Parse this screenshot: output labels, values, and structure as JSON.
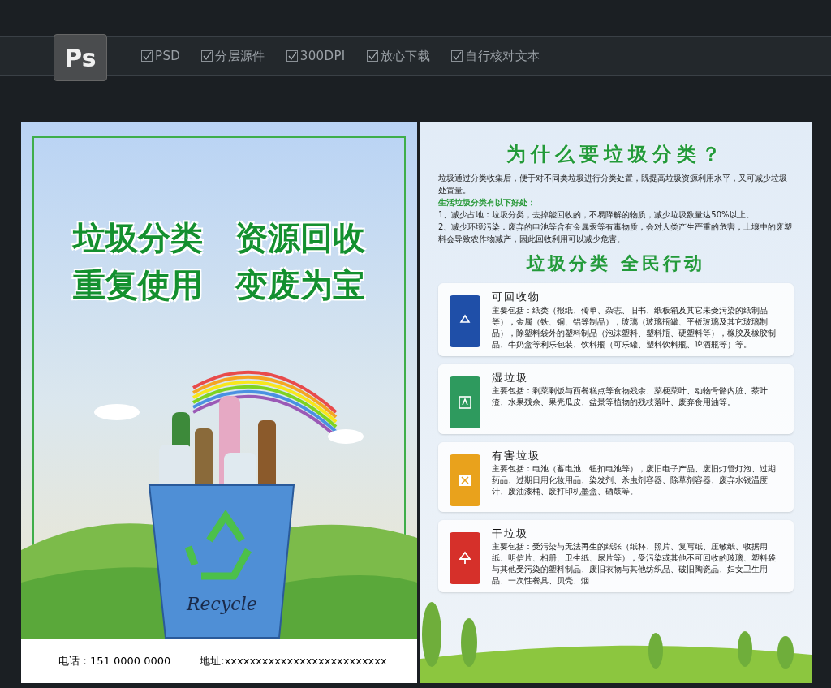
{
  "header": {
    "app_badge": "Ps",
    "features": [
      {
        "label": "PSD",
        "checked": true
      },
      {
        "label": "分层源件",
        "checked": true
      },
      {
        "label": "300DPI",
        "checked": true
      },
      {
        "label": "放心下载",
        "checked": true
      },
      {
        "label": "自行核对文本",
        "checked": true
      }
    ]
  },
  "front": {
    "slogan_lines": [
      "垃圾分类　资源回收",
      "重复使用　变废为宝"
    ],
    "bin_label": "Recycle",
    "phone": "电话：151 0000 0000",
    "address": "地址:xxxxxxxxxxxxxxxxxxxxxxxxxx"
  },
  "back": {
    "title": "为什么要垃圾分类？",
    "intro": "垃圾通过分类收集后，便于对不同类垃圾进行分类处置，既提高垃圾资源利用水平，又可减少垃圾处置量。",
    "benefits_heading": "生活垃圾分类有以下好处：",
    "benefits": [
      "1、减少占地：垃圾分类，去掉能回收的，不易降解的物质，减少垃圾数量达50%以上。",
      "2、减少环境污染：废弃的电池等含有金属汞等有毒物质，会对人类产生严重的危害，土壤中的废塑料会导致农作物减产，因此回收利用可以减少危害。"
    ],
    "subtitle": "垃圾分类 全民行动",
    "categories": [
      {
        "name": "可回收物",
        "color": "#1f4fa8",
        "kind": "recycle",
        "text": "主要包括：纸类（报纸、传单、杂志、旧书、纸板箱及其它未受污染的纸制品等），金属（铁、铜、铝等制品），玻璃（玻璃瓶罐、平板玻璃及其它玻璃制品），除塑料袋外的塑料制品（泡沫塑料、塑料瓶、硬塑料等），橡胶及橡胶制品、牛奶盒等利乐包装、饮料瓶（可乐罐、塑料饮料瓶、啤酒瓶等）等。"
      },
      {
        "name": "湿垃圾",
        "color": "#2e9a5e",
        "kind": "food",
        "text": "主要包括：剩菜剩饭与西餐糕点等食物残余、菜梗菜叶、动物骨骼内脏、茶叶渣、水果残余、果壳瓜皮、盆景等植物的残枝落叶、废弃食用油等。"
      },
      {
        "name": "有害垃圾",
        "color": "#e9a21c",
        "kind": "hazard",
        "text": "主要包括：电池（蓄电池、钮扣电池等），废旧电子产品、废旧灯管灯泡、过期药品、过期日用化妆用品、染发剂、杀虫剂容器、除草剂容器、废弃水银温度计、废油漆桶、废打印机墨盒、硒鼓等。"
      },
      {
        "name": "干垃圾",
        "color": "#d6302a",
        "kind": "tree",
        "text": "主要包括：受污染与无法再生的纸张（纸杯、照片、复写纸、压敏纸、收据用纸、明信片、相册、卫生纸、尿片等），受污染或其他不可回收的玻璃、塑料袋与其他受污染的塑料制品、废旧衣物与其他纺织品、破旧陶瓷品、妇女卫生用品、一次性餐具、贝壳、烟"
      }
    ]
  }
}
